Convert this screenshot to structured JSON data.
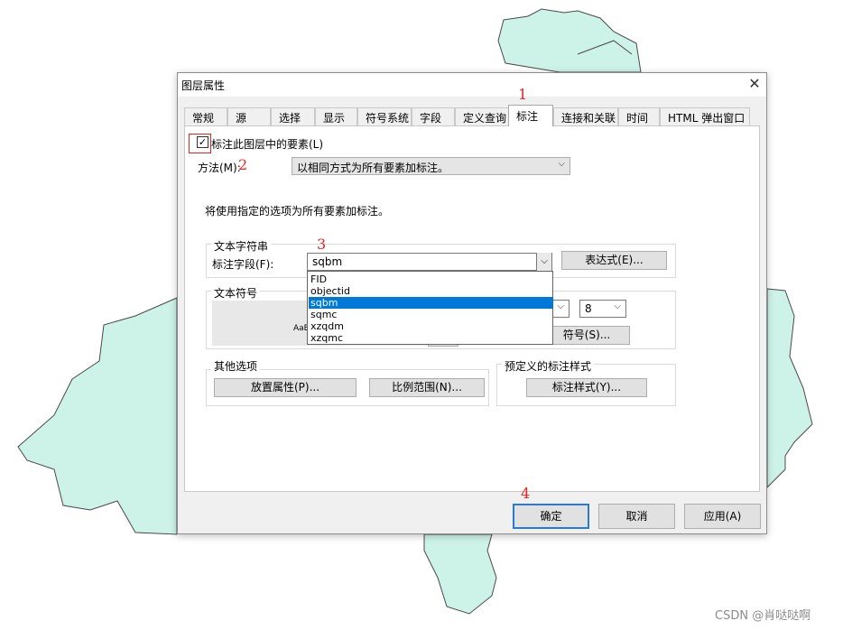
{
  "dialog": {
    "title": "图层属性",
    "close_glyph": "✕",
    "tabs": [
      "常规",
      "源",
      "选择",
      "显示",
      "符号系统",
      "字段",
      "定义查询",
      "标注",
      "连接和关联",
      "时间",
      "HTML 弹出窗口"
    ],
    "active_tab": "标注"
  },
  "label_tab": {
    "checkbox_label": "标注此图层中的要素(L)",
    "checkbox_checked": true,
    "check_glyph": "✓",
    "method_label": "方法(M):",
    "method_value": "以相同方式为所有要素加标注。",
    "info_text": "将使用指定的选项为所有要素加标注。",
    "text_string_group": "文本字符串",
    "label_field_label": "标注字段(F):",
    "label_field_value": "sqbm",
    "expression_button": "表达式(E)...",
    "field_options": [
      "FID",
      "objectid",
      "sqbm",
      "sqmc",
      "xzqdm",
      "xzqmc"
    ],
    "field_selected": "sqbm",
    "text_symbol_group": "文本符号",
    "preview_text": "AaB",
    "font_size_value": "8",
    "symbol_button": "符号(S)...",
    "other_options_group": "其他选项",
    "placement_button": "放置属性(P)...",
    "scale_range_button": "比例范围(N)...",
    "predefined_group": "预定义的标注样式",
    "label_styles_button": "标注样式(Y)...",
    "dropdown_glyph": "⌵"
  },
  "annotations": [
    "1",
    "2",
    "3",
    "4"
  ],
  "footer": {
    "ok": "确定",
    "cancel": "取消",
    "apply": "应用(A)"
  },
  "watermark": "CSDN @肖哒哒啊",
  "colors": {
    "map_fill": "#cdf3e9",
    "annotation_red": "#e8241f",
    "selection_blue": "#0078d7"
  }
}
